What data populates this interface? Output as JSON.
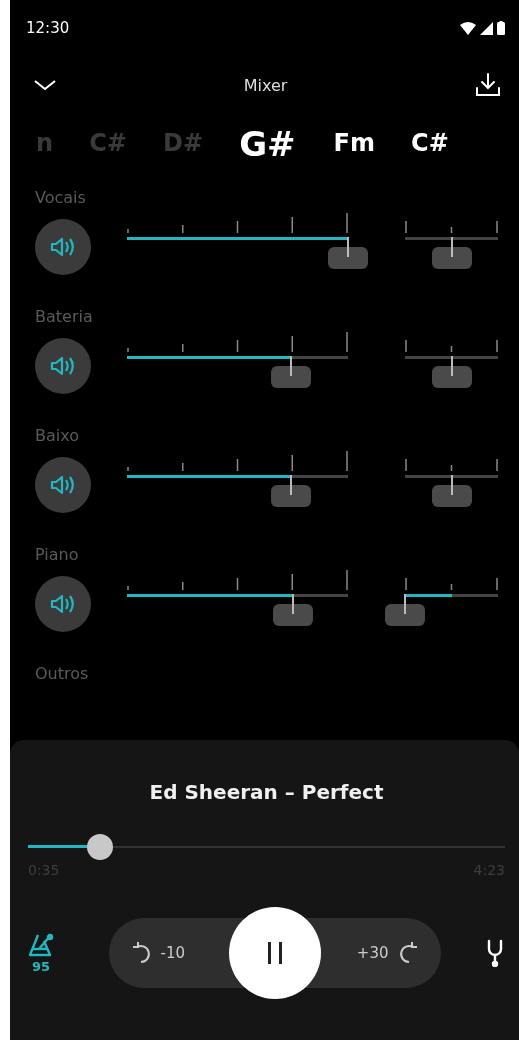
{
  "status_bar": {
    "time": "12:30"
  },
  "header": {
    "title": "Mixer"
  },
  "chords": [
    {
      "label": "n",
      "past": true,
      "selected": false
    },
    {
      "label": "C#",
      "past": true,
      "selected": false
    },
    {
      "label": "D#",
      "past": true,
      "selected": false
    },
    {
      "label": "G#",
      "past": false,
      "selected": true
    },
    {
      "label": "Fm",
      "past": false,
      "selected": false
    },
    {
      "label": "C#",
      "past": false,
      "selected": false
    }
  ],
  "channels": [
    {
      "name": "Vocais",
      "muted": false,
      "volume": {
        "level": 1.0
      },
      "balance": {
        "level": 0.5
      }
    },
    {
      "name": "Bateria",
      "muted": false,
      "volume": {
        "level": 0.74
      },
      "balance": {
        "level": 0.5
      }
    },
    {
      "name": "Baixo",
      "muted": false,
      "volume": {
        "level": 0.74
      },
      "balance": {
        "level": 0.5
      }
    },
    {
      "name": "Piano",
      "muted": false,
      "volume": {
        "level": 0.75
      },
      "balance": {
        "level": 0.0
      }
    },
    {
      "name": "Outros"
    }
  ],
  "player": {
    "title": "Ed Sheeran – Perfect",
    "progress": {
      "level": 0.15
    },
    "elapsed": "0:35",
    "duration": "4:23",
    "tempo": "95",
    "rewind": "-10",
    "forward": "+30",
    "playing": true
  }
}
